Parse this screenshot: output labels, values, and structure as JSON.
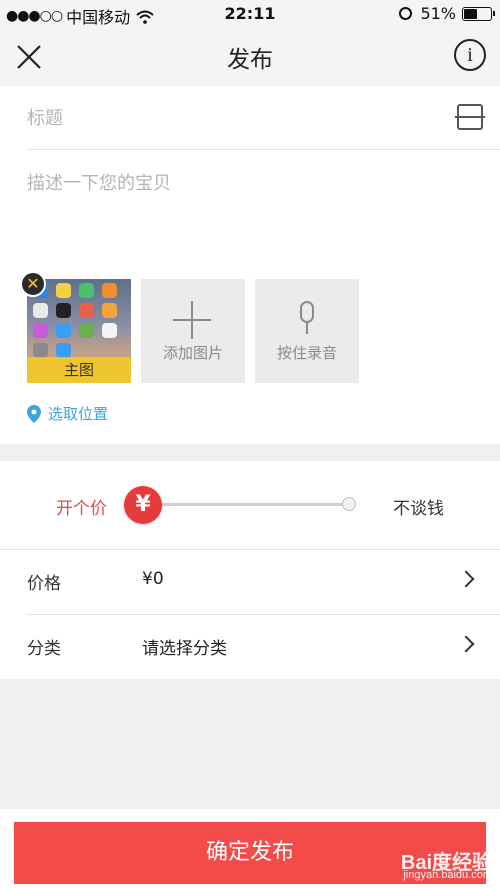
{
  "status_bar": {
    "signal": "●●●○○",
    "carrier": "中国移动",
    "time": "22:11",
    "battery_percent": "51%",
    "battery_level": 0.51,
    "icons": [
      "wifi-icon",
      "alarm-icon",
      "battery-icon"
    ]
  },
  "nav": {
    "title": "发布",
    "close_icon": "close-icon",
    "info_icon": "info-icon",
    "info_glyph": "i"
  },
  "form": {
    "title_placeholder": "标题",
    "description_placeholder": "描述一下您的宝贝",
    "main_image_label": "主图",
    "add_image_label": "添加图片",
    "hold_to_record_label": "按住录音",
    "location_label": "选取位置"
  },
  "price_slider": {
    "left_label": "开个价",
    "right_label": "不谈钱",
    "knob_symbol": "¥",
    "position": 0
  },
  "rows": [
    {
      "label": "价格",
      "value": "¥0"
    },
    {
      "label": "分类",
      "value": "请选择分类"
    }
  ],
  "footer": {
    "publish_label": "确定发布"
  },
  "watermark": {
    "brand": "Bai度经验",
    "url": "jingyan.baidu.com"
  },
  "colors": {
    "accent_red": "#f34a4a",
    "link_blue": "#3aa4e0",
    "page_bg": "#efefef"
  }
}
